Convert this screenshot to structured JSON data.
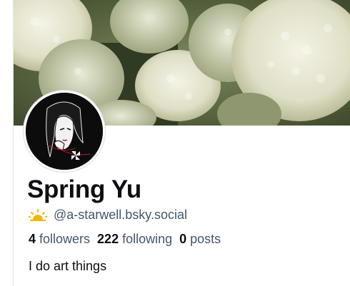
{
  "profile": {
    "display_name": "Spring Yu",
    "handle": "@a-starwell.bsky.social",
    "handle_icon": "sun-icon",
    "bio": "I do art things",
    "stats": {
      "followers_count": "4",
      "followers_label": "followers",
      "following_count": "222",
      "following_label": "following",
      "posts_count": "0",
      "posts_label": "posts"
    }
  },
  "colors": {
    "name": "#0b0f14",
    "muted": "#42576c",
    "sun": "#f2b705",
    "border": "#e3e6ea"
  },
  "images": {
    "banner": "hydrangea-flowers-photo",
    "avatar": "line-art-portrait"
  }
}
